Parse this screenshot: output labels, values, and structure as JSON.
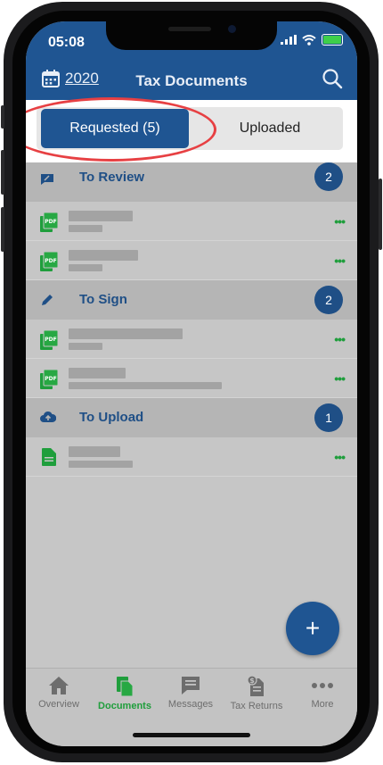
{
  "status_bar": {
    "time": "05:08"
  },
  "header": {
    "year": "2020",
    "title": "Tax Documents"
  },
  "segments": {
    "requested": "Requested (5)",
    "uploaded": "Uploaded"
  },
  "sections": {
    "review": {
      "title": "To Review",
      "count": "2"
    },
    "sign": {
      "title": "To Sign",
      "count": "2"
    },
    "upload": {
      "title": "To Upload",
      "count": "1"
    }
  },
  "fab": {
    "label": "+"
  },
  "row_action": "•••",
  "tabs": {
    "overview": "Overview",
    "documents": "Documents",
    "messages": "Messages",
    "tax_returns": "Tax Returns",
    "more": "More"
  },
  "colors": {
    "brand_blue": "#1f5592",
    "accent_green": "#1f9e3c",
    "highlight_red": "#e74043"
  }
}
